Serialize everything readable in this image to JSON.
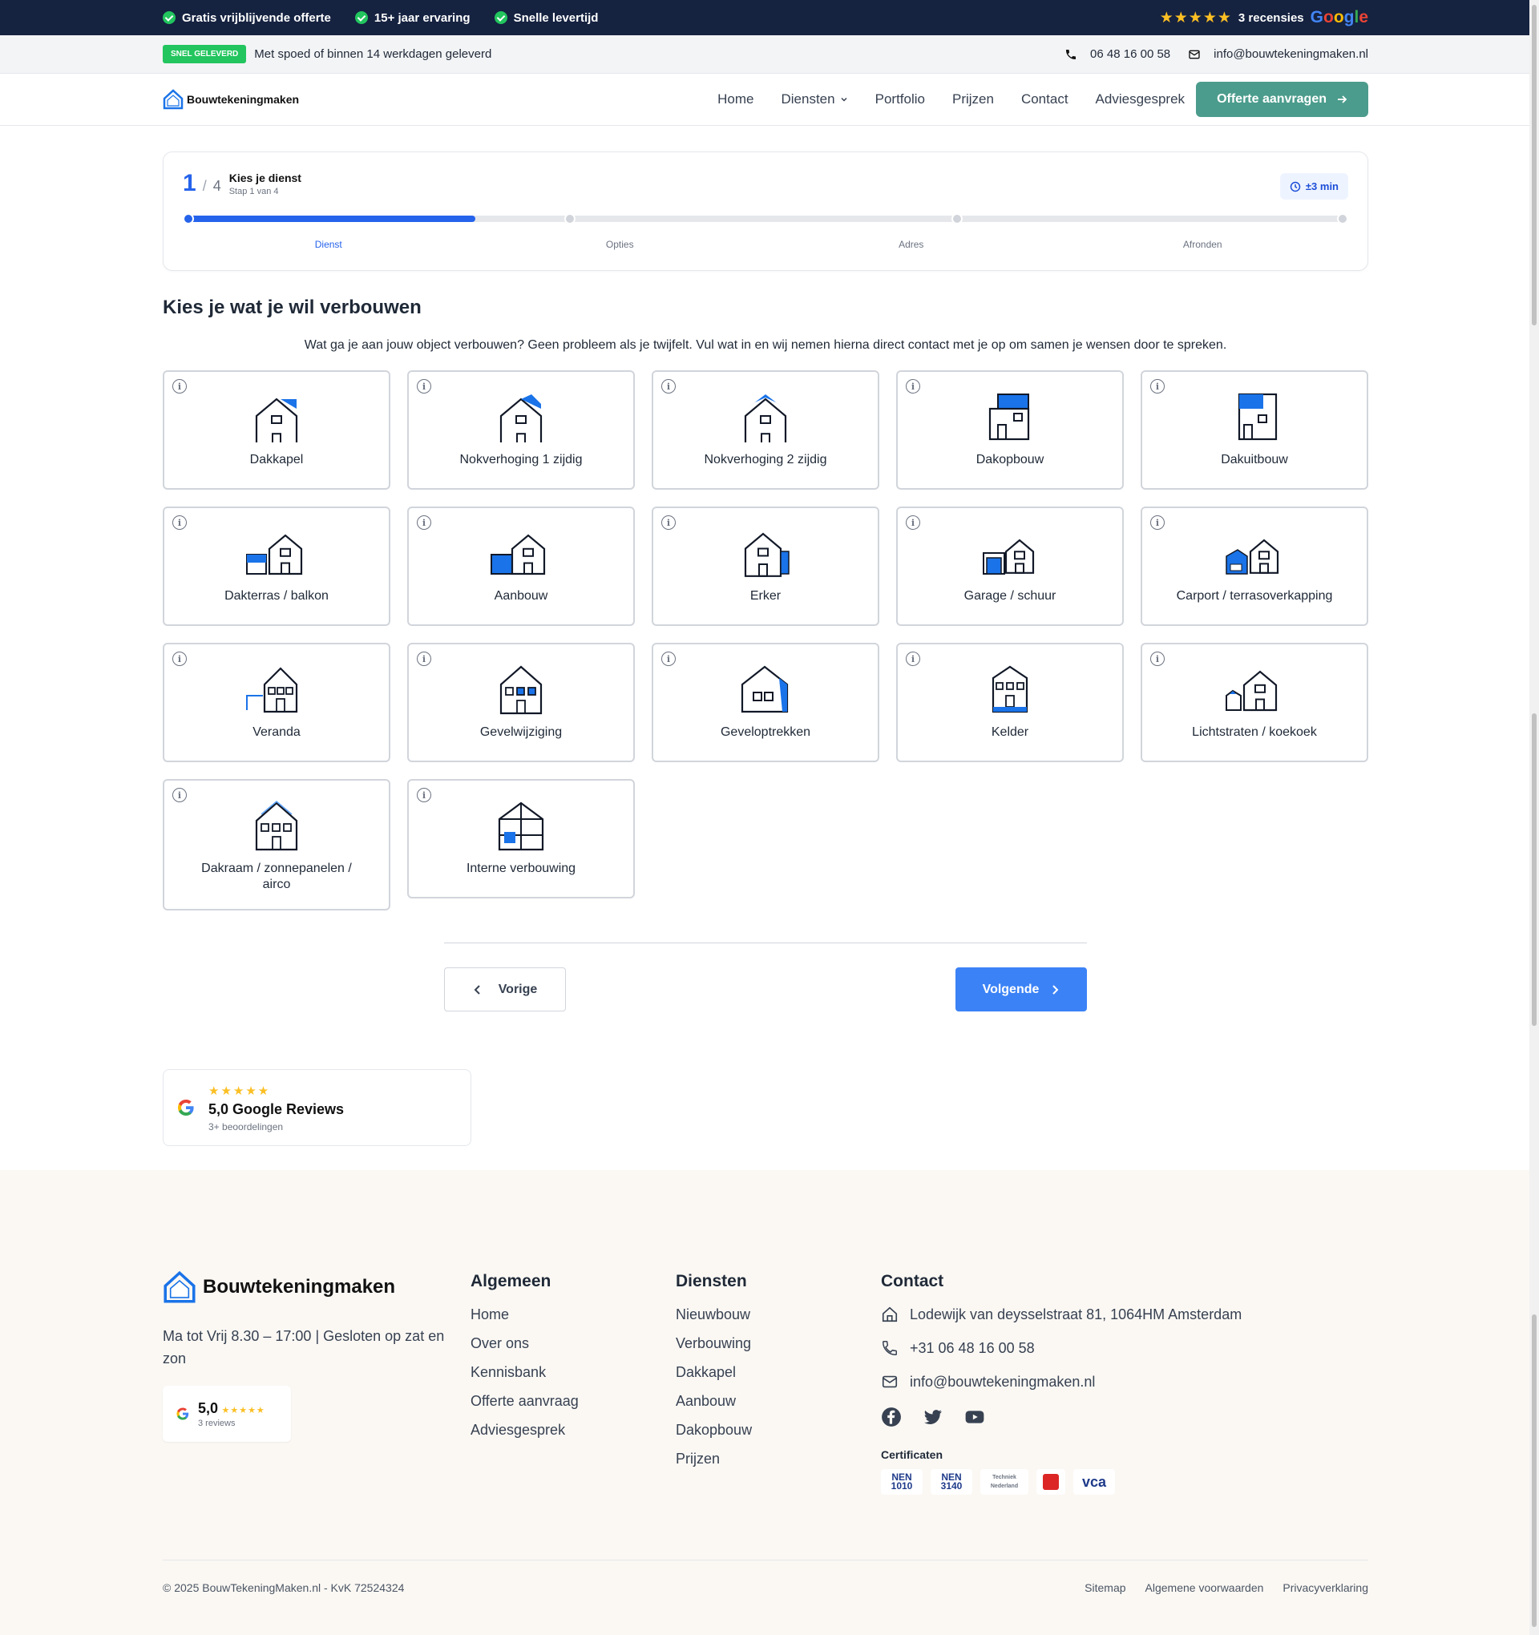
{
  "topbar": {
    "usps": [
      "Gratis vrijblijvende offerte",
      "15+ jaar ervaring",
      "Snelle levertijd"
    ],
    "stars": "★★★★★",
    "reviews": "3 recensies",
    "google": [
      "G",
      "o",
      "o",
      "g",
      "l",
      "e"
    ]
  },
  "infobar": {
    "badge": "SNEL GELEVERD",
    "text": "Met spoed of binnen 14 werkdagen geleverd",
    "phone": "06 48 16 00 58",
    "email": "info@bouwtekeningmaken.nl"
  },
  "nav": {
    "logo": "Bouwtekeningmaken",
    "items": [
      "Home",
      "Diensten",
      "Portfolio",
      "Prijzen",
      "Contact",
      "Adviesgesprek"
    ],
    "cta": "Offerte aanvragen"
  },
  "stepper": {
    "current": "1",
    "sep": "/",
    "total": "4",
    "title": "Kies je dienst",
    "subtitle": "Stap 1 van 4",
    "time": "±3 min",
    "progress": 0.25,
    "labels": [
      "Dienst",
      "Opties",
      "Adres",
      "Afronden"
    ]
  },
  "section": {
    "title": "Kies je wat je wil verbouwen",
    "intro": "Wat ga je aan jouw object verbouwen? Geen probleem als je twijfelt. Vul wat in en wij nemen hierna direct contact met je op om samen je wensen door te spreken."
  },
  "services": [
    {
      "label": "Dakkapel",
      "icon": "dakkapel-icon"
    },
    {
      "label": "Nokverhoging 1 zijdig",
      "icon": "nokverhoging-1-icon"
    },
    {
      "label": "Nokverhoging 2 zijdig",
      "icon": "nokverhoging-2-icon"
    },
    {
      "label": "Dakopbouw",
      "icon": "dakopbouw-icon"
    },
    {
      "label": "Dakuitbouw",
      "icon": "dakuitbouw-icon"
    },
    {
      "label": "Dakterras / balkon",
      "icon": "dakterras-icon"
    },
    {
      "label": "Aanbouw",
      "icon": "aanbouw-icon"
    },
    {
      "label": "Erker",
      "icon": "erker-icon"
    },
    {
      "label": "Garage / schuur",
      "icon": "garage-icon"
    },
    {
      "label": "Carport / terrasoverkapping",
      "icon": "carport-icon"
    },
    {
      "label": "Veranda",
      "icon": "veranda-icon"
    },
    {
      "label": "Gevelwijziging",
      "icon": "gevelwijziging-icon"
    },
    {
      "label": "Geveloptrekken",
      "icon": "geveloptrekken-icon"
    },
    {
      "label": "Kelder",
      "icon": "kelder-icon"
    },
    {
      "label": "Lichtstraten / koekoek",
      "icon": "lichtstraten-icon"
    },
    {
      "label": "Dakraam / zonnepanelen / airco",
      "icon": "dakraam-icon"
    },
    {
      "label": "Interne verbouwing",
      "icon": "interne-verbouwing-icon"
    }
  ],
  "buttons": {
    "prev": "Vorige",
    "next": "Volgende"
  },
  "google_card": {
    "stars": "★★★★★",
    "title": "5,0 Google Reviews",
    "sub": "3+ beoordelingen"
  },
  "footer": {
    "logo": "Bouwtekeningmaken",
    "hours": "Ma tot Vrij 8.30 – 17:00 | Gesloten op zat en zon",
    "rating": "5,0",
    "rating_stars": "★★★★★",
    "rating_sub": "3 reviews",
    "algemeen_title": "Algemeen",
    "algemeen": [
      "Home",
      "Over ons",
      "Kennisbank",
      "Offerte aanvraag",
      "Adviesgesprek"
    ],
    "diensten_title": "Diensten",
    "diensten": [
      "Nieuwbouw",
      "Verbouwing",
      "Dakkapel",
      "Aanbouw",
      "Dakopbouw",
      "Prijzen"
    ],
    "contact_title": "Contact",
    "address": "Lodewijk van deysselstraat 81, 1064HM Amsterdam",
    "phone": "+31 06 48 16 00 58",
    "email": "info@bouwtekeningmaken.nl",
    "cert_title": "Certificaten",
    "certs": [
      "NEN 1010",
      "NEN 3140",
      "Techniek Nederland",
      "",
      "vca"
    ],
    "copyright": "© 2025 BouwTekeningMaken.nl - KvK 72524324",
    "links": [
      "Sitemap",
      "Algemene voorwaarden",
      "Privacyverklaring"
    ]
  },
  "colors": {
    "navy": "#152240",
    "blue": "#2563eb",
    "green": "#22c55e",
    "teal": "#4b9c8c",
    "accent": "#1a73e8"
  }
}
